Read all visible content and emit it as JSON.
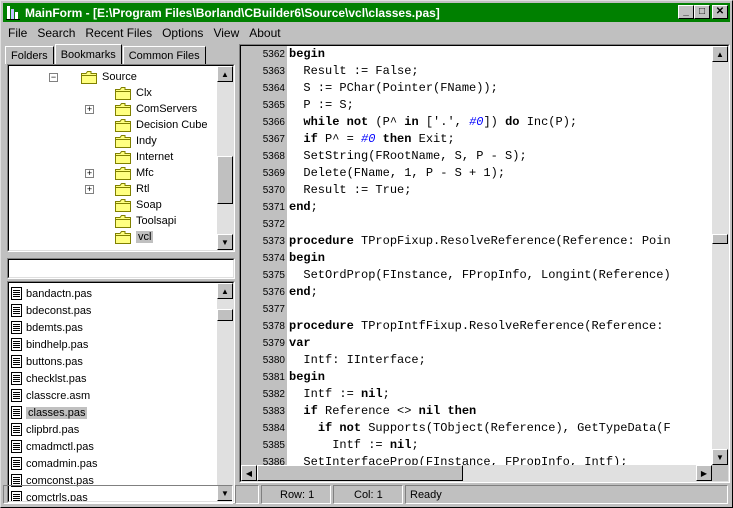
{
  "window": {
    "title": "MainForm - [E:\\Program Files\\Borland\\CBuilder6\\Source\\vcl\\classes.pas]",
    "minimize": "_",
    "maximize": "□",
    "close": "✕"
  },
  "menu": [
    "File",
    "Search",
    "Recent Files",
    "Options",
    "View",
    "About"
  ],
  "tabs": [
    "Folders",
    "Bookmarks",
    "Common Files"
  ],
  "tree": {
    "root": "Source",
    "items": [
      {
        "label": "Clx",
        "expandable": false
      },
      {
        "label": "ComServers",
        "expandable": true
      },
      {
        "label": "Decision Cube",
        "expandable": false
      },
      {
        "label": "Indy",
        "expandable": false
      },
      {
        "label": "Internet",
        "expandable": false
      },
      {
        "label": "Mfc",
        "expandable": true
      },
      {
        "label": "Rtl",
        "expandable": true
      },
      {
        "label": "Soap",
        "expandable": false
      },
      {
        "label": "Toolsapi",
        "expandable": false
      },
      {
        "label": "vcl",
        "expandable": false,
        "selected": true
      }
    ]
  },
  "filter": {
    "value": ""
  },
  "files": [
    "bandactn.pas",
    "bdeconst.pas",
    "bdemts.pas",
    "bindhelp.pas",
    "buttons.pas",
    "checklst.pas",
    "classcre.asm",
    "classes.pas",
    "clipbrd.pas",
    "cmadmctl.pas",
    "comadmin.pas",
    "comconst.pas",
    "comctrls.pas"
  ],
  "selected_file": "classes.pas",
  "code": [
    {
      "n": "5362",
      "t": "begin"
    },
    {
      "n": "5363",
      "t": "  Result := False;"
    },
    {
      "n": "5364",
      "t": "  S := PChar(Pointer(FName));"
    },
    {
      "n": "5365",
      "t": "  P := S;"
    },
    {
      "n": "5366",
      "t": "  while not (P^ in ['.', #0]) do Inc(P);"
    },
    {
      "n": "5367",
      "t": "  if P^ = #0 then Exit;"
    },
    {
      "n": "5368",
      "t": "  SetString(FRootName, S, P - S);"
    },
    {
      "n": "5369",
      "t": "  Delete(FName, 1, P - S + 1);"
    },
    {
      "n": "5370",
      "t": "  Result := True;"
    },
    {
      "n": "5371",
      "t": "end;"
    },
    {
      "n": "5372",
      "t": ""
    },
    {
      "n": "5373",
      "t": "procedure TPropFixup.ResolveReference(Reference: Poin"
    },
    {
      "n": "5374",
      "t": "begin"
    },
    {
      "n": "5375",
      "t": "  SetOrdProp(FInstance, FPropInfo, Longint(Reference)"
    },
    {
      "n": "5376",
      "t": "end;"
    },
    {
      "n": "5377",
      "t": ""
    },
    {
      "n": "5378",
      "t": "procedure TPropIntfFixup.ResolveReference(Reference:"
    },
    {
      "n": "5379",
      "t": "var"
    },
    {
      "n": "5380",
      "t": "  Intf: IInterface;"
    },
    {
      "n": "5381",
      "t": "begin"
    },
    {
      "n": "5382",
      "t": "  Intf := nil;"
    },
    {
      "n": "5383",
      "t": "  if Reference <> nil then"
    },
    {
      "n": "5384",
      "t": "    if not Supports(TObject(Reference), GetTypeData(F"
    },
    {
      "n": "5385",
      "t": "      Intf := nil;"
    },
    {
      "n": "5386",
      "t": "  SetInterfaceProp(FInstance, FPropInfo, Intf);"
    }
  ],
  "keywords": [
    "begin",
    "end",
    "while",
    "not",
    "in",
    "do",
    "if",
    "then",
    "procedure",
    "var",
    "nil"
  ],
  "status": {
    "blank": "",
    "row": "Row: 1",
    "col": "Col: 1",
    "message": "Ready"
  },
  "colors": {
    "titlebar": "#008000",
    "face": "#c0c0c0",
    "number_literal": "#0000ff"
  }
}
